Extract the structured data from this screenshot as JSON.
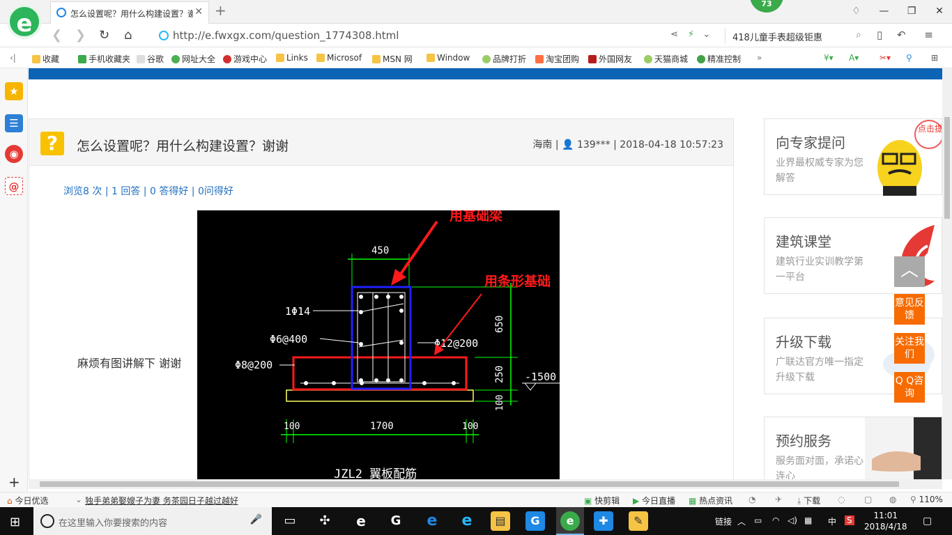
{
  "browser": {
    "logo": "e",
    "tab_title": "怎么设置呢？用什么构建设置？谢",
    "tab_close": "✕",
    "new_tab": "+",
    "badge": "73",
    "url": "http://e.fwxgx.com/question_1774308.html",
    "search_text": "418儿童手表超级钜惠",
    "window_minimize": "—",
    "window_restore": "❐",
    "window_close": "✕"
  },
  "bookmarks": [
    {
      "label": "收藏",
      "icon": "star-icon"
    },
    {
      "label": "手机收藏夹",
      "icon": "phone-icon"
    },
    {
      "label": "谷歌",
      "icon": "page-icon"
    },
    {
      "label": "网址大全",
      "icon": "globe-icon"
    },
    {
      "label": "游戏中心",
      "icon": "game-icon"
    },
    {
      "label": "Links",
      "icon": "folder-icon"
    },
    {
      "label": "Microsof",
      "icon": "folder-icon"
    },
    {
      "label": "MSN 网",
      "icon": "folder-icon"
    },
    {
      "label": "Window",
      "icon": "folder-icon"
    },
    {
      "label": "品牌打折",
      "icon": "leaf-icon"
    },
    {
      "label": "淘宝团购",
      "icon": "taobao-icon"
    },
    {
      "label": "外国网友",
      "icon": "bookmark-icon"
    },
    {
      "label": "天猫商城",
      "icon": "leaf-icon"
    },
    {
      "label": "精准控制",
      "icon": "chat-icon"
    }
  ],
  "question": {
    "title": "怎么设置呢？用什么构建设置？谢谢",
    "location": "海南",
    "user": "139***",
    "datetime": "2018-04-18 10:57:23",
    "stats": {
      "views": "浏览8 次",
      "answers": "1 回答",
      "good_answers": "0 答得好",
      "asked_good": "0问得好"
    },
    "body_text": "麻烦有图讲解下  谢谢"
  },
  "drawing": {
    "annotation_beam": "用基础梁",
    "annotation_strip": "用条形基础",
    "dim_top": "450",
    "label_bar1": "1Φ14",
    "label_stirrup": "Φ6@400",
    "label_bar2": "Φ12@200",
    "label_bar3": "Φ8@200",
    "dim_650": "650",
    "dim_250": "250",
    "dim_100v": "100",
    "elevation": "-1500",
    "dim_100a": "100",
    "dim_1700": "1700",
    "dim_100b": "100",
    "caption": "JZL2 翼板配筋"
  },
  "ads": [
    {
      "title": "向专家提问",
      "sub": "业界最权威专家为您解答",
      "art_text": "点击提问"
    },
    {
      "title": "建筑课堂",
      "sub": "建筑行业实训教学第一平台"
    },
    {
      "title": "升级下载",
      "sub": "广联达官方唯一指定升级下载"
    },
    {
      "title": "预约服务",
      "sub": "服务面对面，承诺心连心"
    }
  ],
  "float_buttons": {
    "top": "︿",
    "feedback": "意见反馈",
    "follow": "关注我们",
    "qq": "Q Q咨询"
  },
  "statusbar": {
    "today": "今日优选",
    "news": "独手弟弟娶嫂子为妻 务茶园日子越过越好",
    "quick_cut": "快剪辑",
    "live": "今日直播",
    "hot": "热点资讯",
    "download": "下载",
    "zoom": "110%"
  },
  "taskbar": {
    "search_placeholder": "在这里输入你要搜索的内容",
    "links": "链接",
    "ime": "中",
    "time": "11:01",
    "date": "2018/4/18"
  }
}
